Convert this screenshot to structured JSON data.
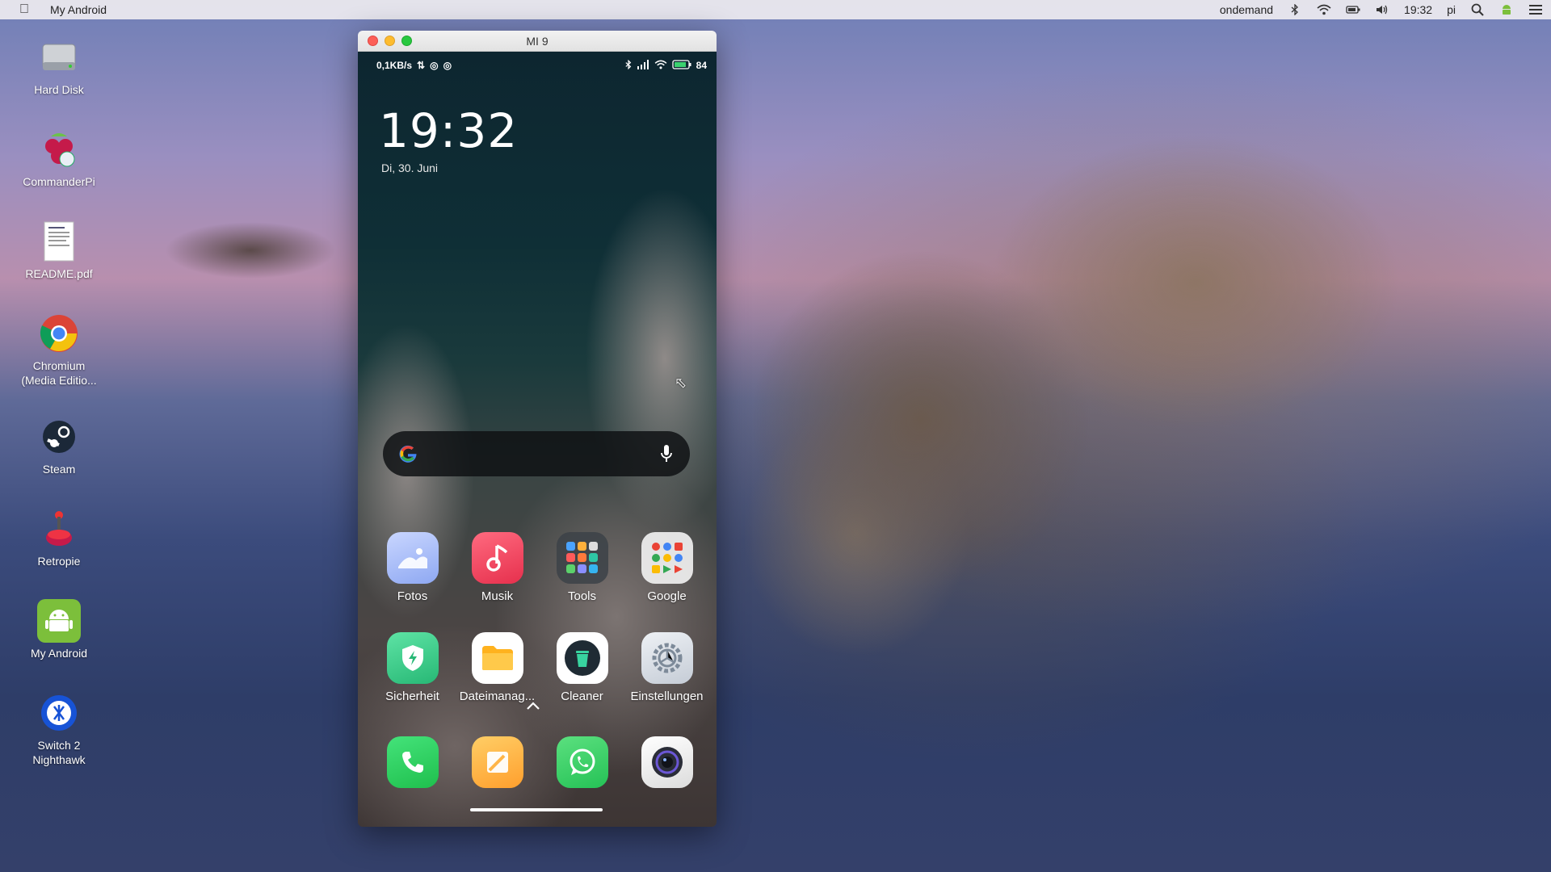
{
  "menubar": {
    "apple_icon": "apple-icon",
    "app_title": "My Android",
    "status_user": "ondemand",
    "time": "19:32",
    "user": "pi"
  },
  "desktop": {
    "items": [
      {
        "label": "Hard Disk",
        "icon": "hard-disk-icon"
      },
      {
        "label": "CommanderPi",
        "icon": "raspberry-pi-icon"
      },
      {
        "label": "README.pdf",
        "icon": "document-icon"
      },
      {
        "label": "Chromium\n(Media Editio...",
        "icon": "chromium-icon"
      },
      {
        "label": "Steam",
        "icon": "steam-icon"
      },
      {
        "label": "Retropie",
        "icon": "retropie-icon"
      },
      {
        "label": "My Android",
        "icon": "android-icon"
      },
      {
        "label": "Switch 2\nNighthawk",
        "icon": "switch-icon"
      }
    ]
  },
  "window": {
    "title": "MI 9"
  },
  "phone": {
    "status_left": "0,1KB/s",
    "battery": "84",
    "clock": "19:32",
    "date": "Di, 30. Juni",
    "apps": [
      {
        "label": "Fotos",
        "color": "#a9bff5"
      },
      {
        "label": "Musik",
        "color": "#f0455c"
      },
      {
        "label": "Tools",
        "color": "#2b3036"
      },
      {
        "label": "Google",
        "color": "#f1f1f1"
      },
      {
        "label": "Sicherheit",
        "color": "#3ccf8e"
      },
      {
        "label": "Dateimanag...",
        "color": "#ffffff"
      },
      {
        "label": "Cleaner",
        "color": "#ffffff"
      },
      {
        "label": "Einstellungen",
        "color": "#d8dde5"
      }
    ],
    "dock": [
      {
        "label": "phone",
        "color": "#2fd05e"
      },
      {
        "label": "notes",
        "color": "#ffb547"
      },
      {
        "label": "whatsapp",
        "color": "#35d166"
      },
      {
        "label": "camera",
        "color": "#f3f3f3"
      }
    ]
  }
}
